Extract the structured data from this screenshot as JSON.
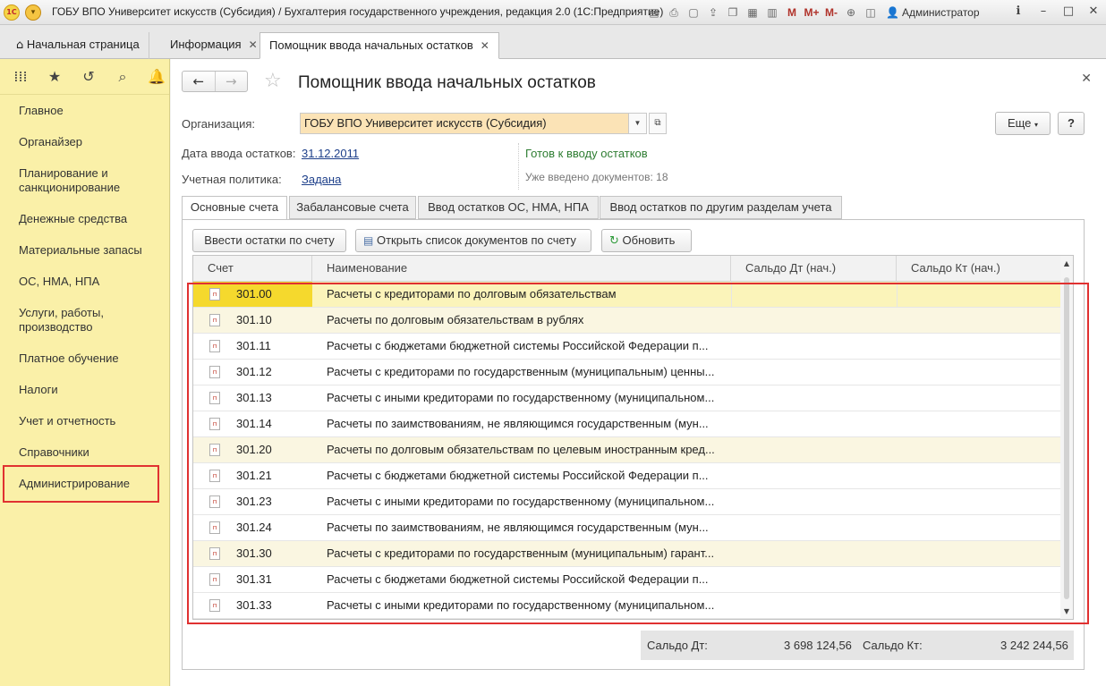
{
  "window": {
    "title": "ГОБУ ВПО Университет искусств (Субсидия) / Бухгалтерия государственного учреждения, редакция 2.0  (1С:Предприятие)",
    "logo": "1С",
    "user": "Администратор",
    "toolbar_m": [
      "M",
      "M+",
      "M-"
    ]
  },
  "tabs": [
    {
      "label": "Начальная страница"
    },
    {
      "label": "Информация"
    },
    {
      "label": "Помощник ввода начальных остатков"
    }
  ],
  "sidebar": {
    "items": [
      {
        "label": "Главное"
      },
      {
        "label": "Органайзер"
      },
      {
        "label": "Планирование и санкционирование"
      },
      {
        "label": "Денежные средства"
      },
      {
        "label": "Материальные запасы"
      },
      {
        "label": "ОС, НМА, НПА"
      },
      {
        "label": "Услуги, работы, производство"
      },
      {
        "label": "Платное обучение"
      },
      {
        "label": "Налоги"
      },
      {
        "label": "Учет и отчетность"
      },
      {
        "label": "Справочники"
      },
      {
        "label": "Администрирование"
      }
    ]
  },
  "form": {
    "title": "Помощник ввода начальных остатков",
    "more_label": "Еще",
    "help_label": "?",
    "org_label": "Организация:",
    "org_value": "ГОБУ ВПО Университет искусств (Субсидия)",
    "date_label": "Дата ввода остатков:",
    "date_value": "31.12.2011",
    "policy_label": "Учетная политика:",
    "policy_value": "Задана",
    "status_ready": "Готов к вводу остатков",
    "status_count": "Уже введено документов:  18"
  },
  "subtabs": [
    {
      "label": "Основные счета"
    },
    {
      "label": "Забалансовые счета"
    },
    {
      "label": "Ввод остатков ОС, НМА, НПА"
    },
    {
      "label": "Ввод остатков по другим разделам учета"
    }
  ],
  "buttons": {
    "enter_balance": "Ввести остатки по счету",
    "open_docs": "Открыть список документов по счету",
    "refresh": "Обновить"
  },
  "grid": {
    "columns": [
      "Счет",
      "Наименование",
      "Сальдо Дт (нач.)",
      "Сальдо Кт (нач.)"
    ],
    "rows": [
      {
        "code": "301.00",
        "name": "Расчеты с кредиторами по долговым обязательствам"
      },
      {
        "code": "301.10",
        "name": "Расчеты по долговым обязательствам в рублях"
      },
      {
        "code": "301.11",
        "name": "Расчеты с бюджетами бюджетной системы Российской Федерации п..."
      },
      {
        "code": "301.12",
        "name": "Расчеты с кредиторами по государственным (муниципальным) ценны..."
      },
      {
        "code": "301.13",
        "name": "Расчеты с иными кредиторами по государственному (муниципальном..."
      },
      {
        "code": "301.14",
        "name": "Расчеты по заимствованиям, не являющимся  государственным (мун..."
      },
      {
        "code": "301.20",
        "name": "Расчеты по долговым обязательствам по целевым иностранным кред..."
      },
      {
        "code": "301.21",
        "name": "Расчеты с бюджетами бюджетной системы Российской Федерации п..."
      },
      {
        "code": "301.23",
        "name": "Расчеты с иными кредиторами по государственному (муниципальном..."
      },
      {
        "code": "301.24",
        "name": "Расчеты по заимствованиям, не являющимся государственным (мун..."
      },
      {
        "code": "301.30",
        "name": "Расчеты с кредиторами по государственным (муниципальным) гарант..."
      },
      {
        "code": "301.31",
        "name": "Расчеты с бюджетами бюджетной системы Российской Федерации п..."
      },
      {
        "code": "301.33",
        "name": "Расчеты с иными кредиторами по государственному (муниципальном..."
      }
    ]
  },
  "totals": {
    "dt_label": "Сальдо Дт:",
    "dt_value": "3 698 124,56",
    "kt_label": "Сальдо Кт:",
    "kt_value": "3 242 244,56"
  }
}
